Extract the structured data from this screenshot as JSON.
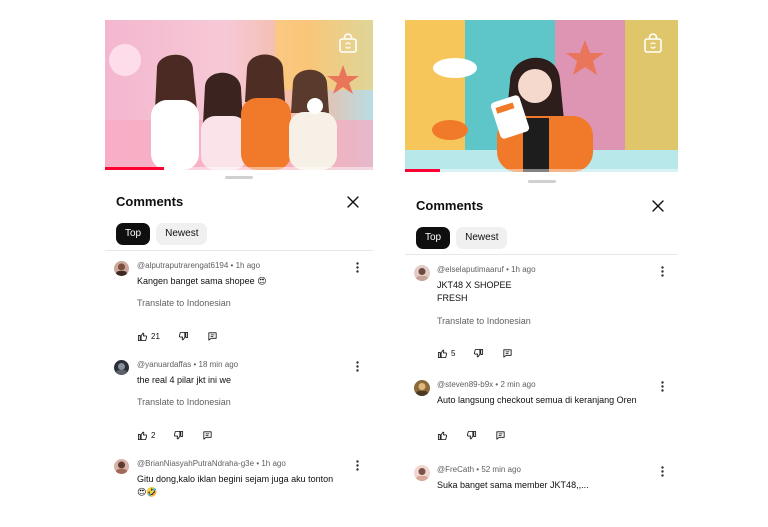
{
  "left": {
    "sheet": {
      "title": "Comments",
      "chips": [
        "Top",
        "Newest"
      ]
    },
    "comments": [
      {
        "author": "@alputraputrarengat6194",
        "time": "1h ago",
        "text": "Kangen banget sama shopee 😍",
        "translate": "Translate to Indonesian",
        "likes": "21"
      },
      {
        "author": "@yanuardaffas",
        "time": "18 min ago",
        "text": "the real 4 pilar jkt ini  we",
        "translate": "Translate to Indonesian",
        "likes": "2"
      },
      {
        "author": "@BrianNiasyahPutraNdraha-g3e",
        "time": "1h ago",
        "text": "Gitu dong,kalo iklan begini sejam juga aku tonton😍🤣"
      }
    ]
  },
  "right": {
    "sheet": {
      "title": "Comments",
      "chips": [
        "Top",
        "Newest"
      ]
    },
    "comments": [
      {
        "author": "@elselaputimaaruf",
        "time": "1h ago",
        "text": "JKT48 X SHOPEE\nFRESH",
        "translate": "Translate to Indonesian",
        "likes": "5"
      },
      {
        "author": "@steven89-b9x",
        "time": "2 min ago",
        "text": "Auto langsung checkout semua di keranjang Oren"
      },
      {
        "author": "@FreCath",
        "time": "52 min ago",
        "text": "Suka banget sama member JKT48,,..."
      }
    ]
  },
  "meta_separator": "•",
  "colors": {
    "accent_red": "#ff0033",
    "text_primary": "#0f0f0f",
    "text_secondary": "#606060",
    "chip_bg": "#f0f0f0",
    "chip_active_bg": "#0f0f0f"
  },
  "icons": [
    "shopping-bag-icon",
    "close-icon",
    "more-vert-icon",
    "thumb-up-icon",
    "thumb-down-icon",
    "reply-icon"
  ],
  "video": {
    "left_progress": 0.22,
    "right_progress": 0.13
  }
}
